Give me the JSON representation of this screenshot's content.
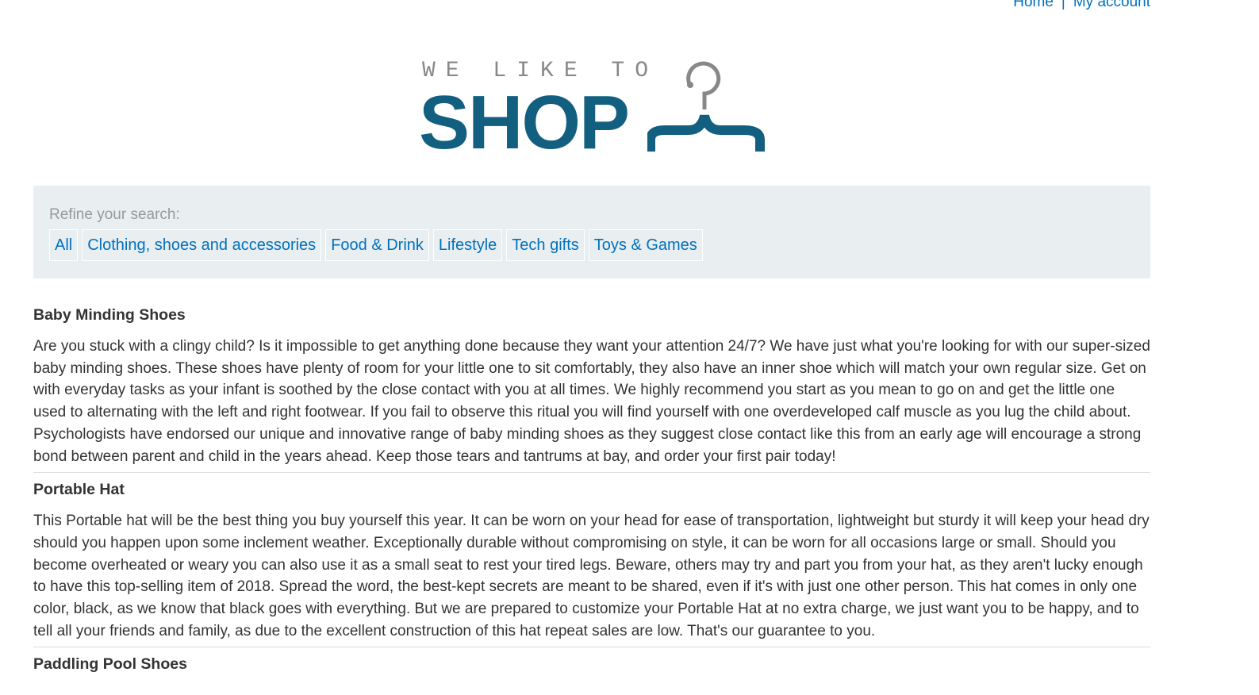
{
  "nav": {
    "home": "Home",
    "separator": "|",
    "account": "My account"
  },
  "logo": {
    "tagline": "WE LIKE TO",
    "word": "SHOP",
    "icon": "coat-hanger-icon",
    "brand_color": "#135f80",
    "tagline_color": "#888888"
  },
  "filters": {
    "label": "Refine your search:",
    "categories": [
      "All",
      "Clothing, shoes and accessories",
      "Food & Drink",
      "Lifestyle",
      "Tech gifts",
      "Toys & Games"
    ]
  },
  "colors": {
    "link": "#0071bc",
    "panel": "#e9eef1",
    "text": "#333333"
  },
  "products": [
    {
      "title": "Baby Minding Shoes",
      "description": "Are you stuck with a clingy child? Is it impossible to get anything done because they want your attention 24/7? We have just what you're looking for with our super-sized baby minding shoes. These shoes have plenty of room for your little one to sit comfortably, they also have an inner shoe which will match your own regular size. Get on with everyday tasks as your infant is soothed by the close contact with you at all times. We highly recommend you start as you mean to go on and get the little one used to alternating with the left and right footwear. If you fail to observe this ritual you will find yourself with one overdeveloped calf muscle as you lug the child about. Psychologists have endorsed our unique and innovative range of baby minding shoes as they suggest close contact like this from an early age will encourage a strong bond between parent and child in the years ahead. Keep those tears and tantrums at bay, and order your first pair today!"
    },
    {
      "title": "Portable Hat",
      "description": "This Portable hat will be the best thing you buy yourself this year. It can be worn on your head for ease of transportation, lightweight but sturdy it will keep your head dry should you happen upon some inclement weather. Exceptionally durable without compromising on style, it can be worn for all occasions large or small. Should you become overheated or weary you can also use it as a small seat to rest your tired legs. Beware, others may try and part you from your hat, as they aren't lucky enough to have this top-selling item of 2018. Spread the word, the best-kept secrets are meant to be shared, even if it's with just one other person. This hat comes in only one color, black, as we know that black goes with everything. But we are prepared to customize your Portable Hat at no extra charge, we just want you to be happy, and to tell all your friends and family, as due to the excellent construction of this hat repeat sales are low. That's our guarantee to you."
    },
    {
      "title": "Paddling Pool Shoes"
    }
  ]
}
